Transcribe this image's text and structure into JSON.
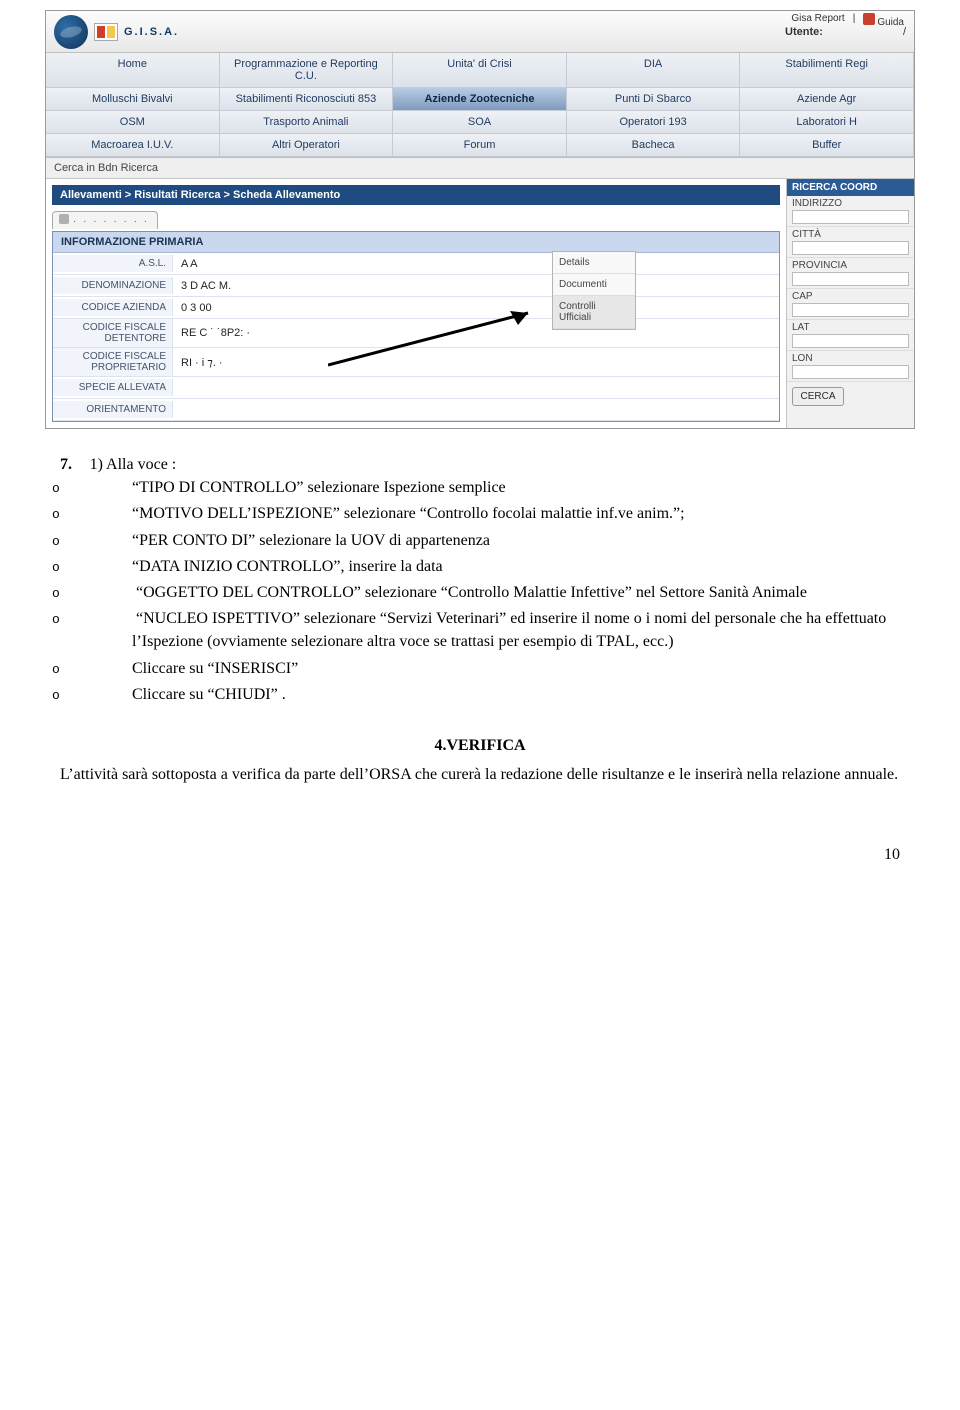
{
  "top": {
    "brand": "G.I.S.A.",
    "utente_label": "Utente:",
    "utente_sep": "/",
    "link_report": "Gisa Report",
    "link_guida": "Guida"
  },
  "nav": {
    "rows": [
      [
        "Home",
        "Programmazione e Reporting C.U.",
        "Unita' di Crisi",
        "DIA",
        "Stabilimenti Regi"
      ],
      [
        "Molluschi Bivalvi",
        "Stabilimenti Riconosciuti 853",
        "Aziende Zootecniche",
        "Punti Di Sbarco",
        "Aziende Agr"
      ],
      [
        "OSM",
        "Trasporto Animali",
        "SOA",
        "Operatori 193",
        "Laboratori H"
      ],
      [
        "Macroarea I.U.V.",
        "Altri Operatori",
        "Forum",
        "Bacheca",
        "Buffer"
      ]
    ],
    "selected": "Aziende Zootecniche"
  },
  "subnav": "Cerca in Bdn   Ricerca",
  "breadcrumb": "Allevamenti > Risultati Ricerca > Scheda Allevamento",
  "form": {
    "header": "INFORMAZIONE PRIMARIA",
    "rows": [
      {
        "label": "A.S.L.",
        "value": "A      A"
      },
      {
        "label": "DENOMINAZIONE",
        "value": "3   D   AC  M."
      },
      {
        "label": "CODICE AZIENDA",
        "value": "0  3     00"
      },
      {
        "label": "CODICE FISCALE DETENTORE",
        "value": "RE  C ˙  ˙8P2:     ·"
      },
      {
        "label": "CODICE FISCALE PROPRIETARIO",
        "value": "RI        ·  i   ⁊.  ·"
      },
      {
        "label": "SPECIE ALLEVATA",
        "value": ""
      },
      {
        "label": "ORIENTAMENTO",
        "value": ""
      }
    ]
  },
  "side_menu": [
    "Details",
    "Documenti",
    "Controlli Ufficiali"
  ],
  "right_panel": {
    "header": "RICERCA COORD",
    "fields": [
      "INDIRIZZO",
      "CITTÀ",
      "PROVINCIA",
      "CAP",
      "LAT",
      "LON"
    ],
    "button": "CERCA"
  },
  "doc": {
    "num": "7.",
    "intro": "1) Alla voce :",
    "bullets": [
      "“TIPO DI CONTROLLO” selezionare Ispezione semplice",
      "“MOTIVO DELL’ISPEZIONE” selezionare “Controllo focolai malattie inf.ve anim.”;",
      "“PER CONTO DI” selezionare la UOV di appartenenza",
      "“DATA INIZIO CONTROLLO”, inserire la data",
      "“OGGETTO DEL CONTROLLO” selezionare “Controllo Malattie Infettive” nel Settore Sanità Animale",
      "“NUCLEO ISPETTIVO” selezionare “Servizi Veterinari” ed inserire il nome o i nomi del personale che ha effettuato l’Ispezione (ovviamente selezionare altra voce se trattasi per esempio di TPAL, ecc.)",
      "Cliccare su “INSERISCI”",
      "Cliccare su “CHIUDI” ."
    ],
    "indent_flags": [
      false,
      false,
      false,
      false,
      true,
      true,
      false,
      false
    ],
    "section_title": "4.VERIFICA",
    "section_body": "L’attività sarà sottoposta a verifica da parte dell’ORSA che curerà la redazione delle risultanze e le inserirà nella relazione annuale.",
    "page_number": "10"
  }
}
